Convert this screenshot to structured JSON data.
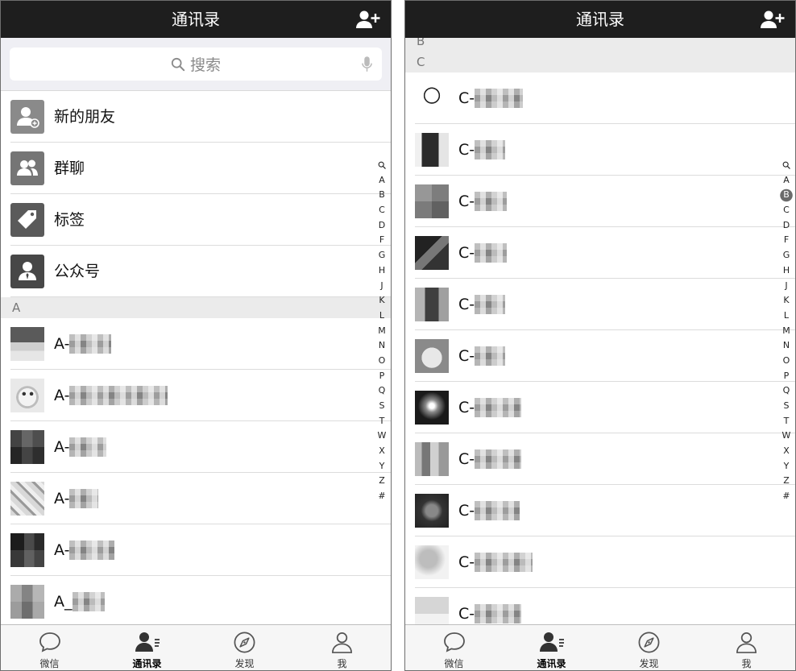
{
  "left": {
    "header": {
      "title": "通讯录",
      "icon": "add-user-icon"
    },
    "search": {
      "placeholder": "搜索",
      "icon": "search-icon",
      "voice_icon": "microphone-icon"
    },
    "functions": [
      {
        "label": "新的朋友",
        "icon": "add-friend-icon"
      },
      {
        "label": "群聊",
        "icon": "group-chat-icon"
      },
      {
        "label": "标签",
        "icon": "tag-icon"
      },
      {
        "label": "公众号",
        "icon": "official-account-icon"
      }
    ],
    "sections": [
      {
        "letter": "A",
        "contacts": [
          {
            "prefix": "A-"
          },
          {
            "prefix": "A-"
          },
          {
            "prefix": "A-"
          },
          {
            "prefix": "A-"
          },
          {
            "prefix": "A-"
          },
          {
            "prefix": "A_"
          }
        ]
      }
    ]
  },
  "right": {
    "header": {
      "title": "通讯录",
      "icon": "add-user-icon"
    },
    "sections": [
      {
        "letter": "B",
        "contacts": []
      },
      {
        "letter": "C",
        "contacts": [
          {
            "prefix": "C-"
          },
          {
            "prefix": "C-"
          },
          {
            "prefix": "C-"
          },
          {
            "prefix": "C-"
          },
          {
            "prefix": "C-"
          },
          {
            "prefix": "C-"
          },
          {
            "prefix": "C-"
          },
          {
            "prefix": "C-"
          },
          {
            "prefix": "C-"
          },
          {
            "prefix": "C-"
          },
          {
            "prefix": "C-"
          }
        ]
      }
    ],
    "index_highlight": "B"
  },
  "index": {
    "search_icon": "index-search-icon",
    "letters": [
      "A",
      "B",
      "C",
      "D",
      "F",
      "G",
      "H",
      "J",
      "K",
      "L",
      "M",
      "N",
      "O",
      "P",
      "Q",
      "S",
      "T",
      "W",
      "X",
      "Y",
      "Z",
      "#"
    ]
  },
  "tabbar": [
    {
      "label": "微信",
      "icon": "chat-icon"
    },
    {
      "label": "通讯录",
      "icon": "contacts-icon",
      "active": true
    },
    {
      "label": "发现",
      "icon": "discover-icon"
    },
    {
      "label": "我",
      "icon": "me-icon"
    }
  ],
  "colors": {
    "header_bg": "#1e1e1e",
    "header_text": "#ffffff",
    "section_bg": "#ebebeb",
    "search_bg": "#efeff4",
    "index_highlight_bg": "#6b6b6b"
  }
}
